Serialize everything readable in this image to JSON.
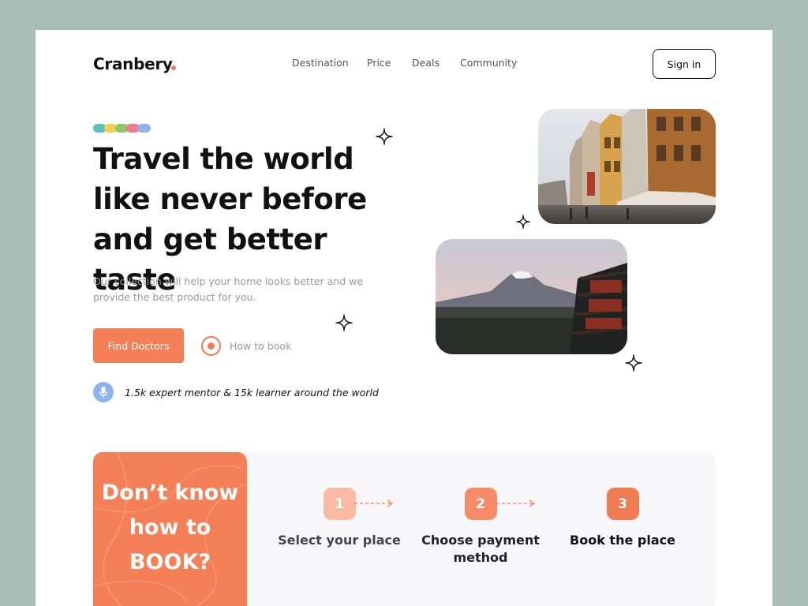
{
  "brand": {
    "name": "Cranbery",
    "accent": "#f07c52"
  },
  "nav": {
    "items": [
      "Destination",
      "Price",
      "Deals",
      "Community"
    ]
  },
  "header": {
    "signin_label": "Sign in"
  },
  "hero": {
    "decor_colors": [
      "#5dbfbf",
      "#f3cf55",
      "#8cc86a",
      "#f27a8c",
      "#8fb2f0"
    ],
    "title": "Travel the world like never before and get better taste",
    "subtitle": "Our collection will help your home looks better and we provide the best product for you.",
    "primary_button": "Find Doctors",
    "secondary_link": "How to book",
    "stats": "1.5k expert mentor & 15k learner around the world",
    "stats_icon": "microphone-icon"
  },
  "booking": {
    "question": "Don’t know how to BOOK?",
    "steps": [
      {
        "number": "1",
        "label": "Select your place",
        "color": "#f9b9a3"
      },
      {
        "number": "2",
        "label": "Choose payment method",
        "color": "#f58b67"
      },
      {
        "number": "3",
        "label": "Book the place",
        "color": "#f07c52"
      }
    ]
  }
}
